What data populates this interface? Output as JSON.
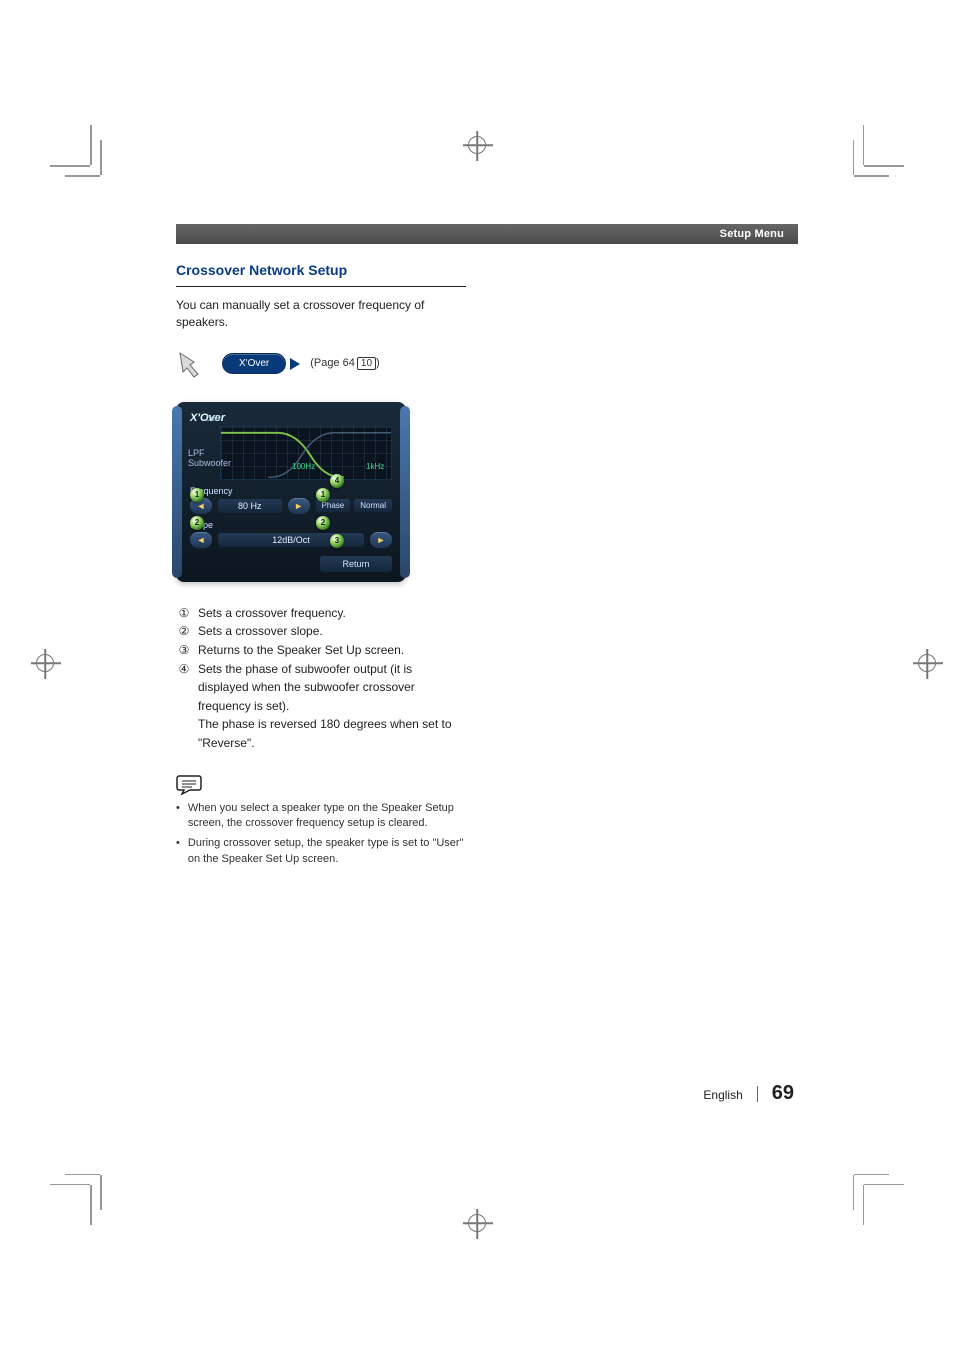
{
  "header": {
    "label": "Setup Menu"
  },
  "section": {
    "title": "Crossover Network Setup"
  },
  "intro": "You can manually set a crossover frequency of speakers.",
  "nav": {
    "chip": "X'Over",
    "page_prefix": "(Page 64",
    "page_box": "10",
    "page_suffix": ")"
  },
  "device": {
    "title": "X'Over",
    "db0": "0dB",
    "lpf": "LPF",
    "sub": "Subwoofer",
    "x100": "100Hz",
    "x1k": "1kHz",
    "rows": {
      "freq_label": "Frequency",
      "freq_value": "80 Hz",
      "slope_label": "Slope",
      "slope_value": "12dB/Oct",
      "phase_label": "Phase",
      "phase_value": "Normal",
      "return": "Return"
    },
    "marks": {
      "m1": "1",
      "m2": "2",
      "m3": "3",
      "m4": "4"
    },
    "arrows": {
      "left": "◄",
      "right": "►"
    }
  },
  "legend": {
    "items": [
      {
        "n": "①",
        "t": "Sets a crossover frequency."
      },
      {
        "n": "②",
        "t": "Sets a crossover slope."
      },
      {
        "n": "③",
        "t": "Returns to the Speaker Set Up screen."
      },
      {
        "n": "④",
        "t": "Sets the phase of subwoofer output (it is displayed when the subwoofer crossover frequency is set)."
      }
    ],
    "cont": "The phase is reversed 180 degrees when set to \"Reverse\"."
  },
  "notes": {
    "bullet": "•",
    "items": [
      "When you select a speaker type on the Speaker Setup screen, the crossover frequency setup is cleared.",
      "During crossover setup, the speaker type is set to \"User\" on the Speaker Set Up screen."
    ]
  },
  "footer": {
    "lang": "English",
    "page": "69"
  }
}
